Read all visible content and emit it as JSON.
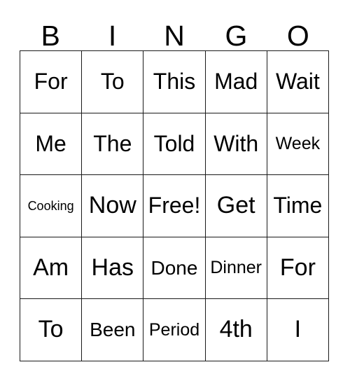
{
  "card": {
    "header_letters": [
      "B",
      "I",
      "N",
      "G",
      "O"
    ],
    "colors": {
      "background": "#ffffff",
      "border": "#1a1a1a",
      "text": "#000000"
    },
    "grid": {
      "columns": 5,
      "rows": 5,
      "cells": [
        [
          {
            "label": "For",
            "size": "lg"
          },
          {
            "label": "To",
            "size": "lg"
          },
          {
            "label": "This",
            "size": "lg"
          },
          {
            "label": "Mad",
            "size": "lg"
          },
          {
            "label": "Wait",
            "size": "lg"
          }
        ],
        [
          {
            "label": "Me",
            "size": "lg"
          },
          {
            "label": "The",
            "size": "lg"
          },
          {
            "label": "Told",
            "size": "lg"
          },
          {
            "label": "With",
            "size": "lg"
          },
          {
            "label": "Week",
            "size": "sm"
          }
        ],
        [
          {
            "label": "Cooking",
            "size": "xs"
          },
          {
            "label": "Now",
            "size": "xl"
          },
          {
            "label": "Free!",
            "size": "lg"
          },
          {
            "label": "Get",
            "size": "xl"
          },
          {
            "label": "Time",
            "size": "lg"
          }
        ],
        [
          {
            "label": "Am",
            "size": "xl"
          },
          {
            "label": "Has",
            "size": "xl"
          },
          {
            "label": "Done",
            "size": "md"
          },
          {
            "label": "Dinner",
            "size": "sm"
          },
          {
            "label": "For",
            "size": "xl"
          }
        ],
        [
          {
            "label": "To",
            "size": "xl"
          },
          {
            "label": "Been",
            "size": "md"
          },
          {
            "label": "Period",
            "size": "sm"
          },
          {
            "label": "4th",
            "size": "xl"
          },
          {
            "label": "I",
            "size": "xl"
          }
        ]
      ]
    }
  }
}
